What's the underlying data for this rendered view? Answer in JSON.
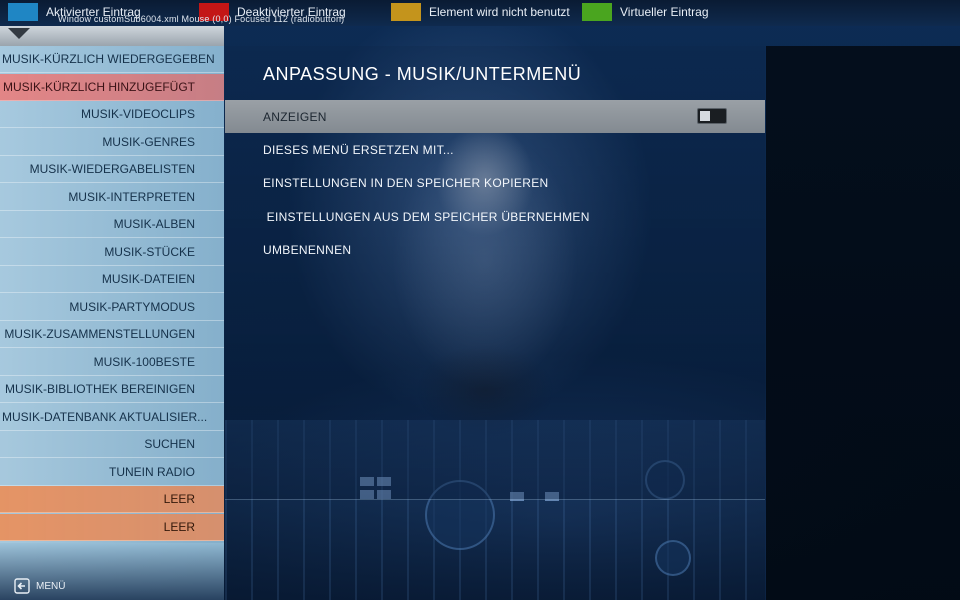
{
  "legend": [
    {
      "label": "Aktivierter Eintrag",
      "color": "#1f86c4"
    },
    {
      "label": "Deaktivierter Eintrag",
      "color": "#c31616"
    },
    {
      "label": "Element wird nicht benutzt",
      "color": "#c4941c"
    },
    {
      "label": "Virtueller Eintrag",
      "color": "#4aa51f"
    }
  ],
  "debug_line": "Window  customSub6004.xml  Mouse  (0,0)  Focused  112 (radiobutton)",
  "sidebar": {
    "items": [
      {
        "label": "MUSIK-KÜRZLICH WIEDERGEGEBEN",
        "state": "left"
      },
      {
        "label": "MUSIK-KÜRZLICH HINZUGEFÜGT",
        "state": "deactivated"
      },
      {
        "label": "MUSIK-VIDEOCLIPS",
        "state": "normal"
      },
      {
        "label": "MUSIK-GENRES",
        "state": "normal"
      },
      {
        "label": "MUSIK-WIEDERGABELISTEN",
        "state": "normal"
      },
      {
        "label": "MUSIK-INTERPRETEN",
        "state": "normal"
      },
      {
        "label": "MUSIK-ALBEN",
        "state": "normal"
      },
      {
        "label": "MUSIK-STÜCKE",
        "state": "normal"
      },
      {
        "label": "MUSIK-DATEIEN",
        "state": "normal"
      },
      {
        "label": "MUSIK-PARTYMODUS",
        "state": "normal"
      },
      {
        "label": "MUSIK-ZUSAMMENSTELLUNGEN",
        "state": "normal"
      },
      {
        "label": "MUSIK-100BESTE",
        "state": "normal"
      },
      {
        "label": "MUSIK-BIBLIOTHEK BEREINIGEN",
        "state": "normal"
      },
      {
        "label": "MUSIK-DATENBANK AKTUALISIER...",
        "state": "left"
      },
      {
        "label": "SUCHEN",
        "state": "normal"
      },
      {
        "label": "TUNEIN RADIO",
        "state": "normal"
      },
      {
        "label": "LEER",
        "state": "empty"
      },
      {
        "label": "LEER",
        "state": "empty"
      }
    ],
    "back_label": "MENÜ"
  },
  "panel": {
    "title": "ANPASSUNG - MUSIK/UNTERMENÜ",
    "options": [
      {
        "label": "ANZEIGEN",
        "focused": true,
        "toggle": false
      },
      {
        "label": "DIESES MENÜ ERSETZEN MIT...",
        "focused": false
      },
      {
        "label": "EINSTELLUNGEN IN DEN SPEICHER KOPIEREN",
        "focused": false
      },
      {
        "label": " EINSTELLUNGEN AUS DEM SPEICHER ÜBERNEHMEN",
        "focused": false
      },
      {
        "label": "UMBENENNEN",
        "focused": false
      }
    ]
  }
}
